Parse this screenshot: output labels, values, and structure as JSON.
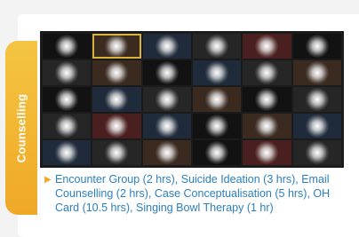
{
  "side_tab": {
    "label": "Counselling"
  },
  "video_grid": {
    "columns": 6,
    "rows": 5,
    "selected_tile": 2
  },
  "caption": {
    "text": "Encounter Group (2 hrs), Suicide Ideation (3 hrs), Email Counselling (2 hrs), Case Conceptualisation (5 hrs), OH Card (10.5 hrs), Singing Bowl Therapy (1 hr)"
  },
  "colors": {
    "accent_yellow": "#f0a827",
    "caption_blue": "#2b7fbf",
    "grid_background": "#1b1b1b"
  }
}
